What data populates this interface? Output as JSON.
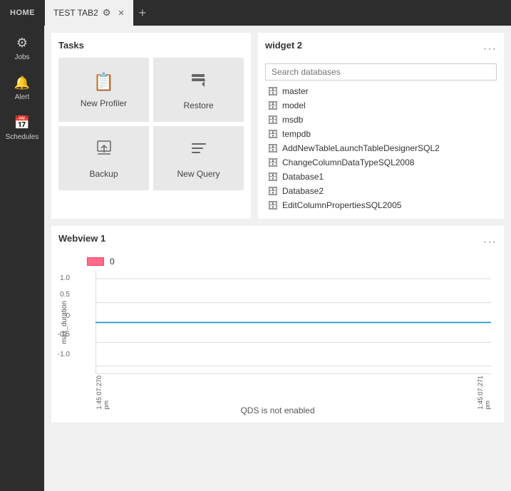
{
  "topbar": {
    "home_label": "HOME",
    "tab_label": "TEST TAB2",
    "tab_add_icon": "+"
  },
  "sidebar": {
    "items": [
      {
        "id": "jobs",
        "icon": "⚙",
        "label": "Jobs"
      },
      {
        "id": "alert",
        "icon": "🔔",
        "label": "Alert"
      },
      {
        "id": "schedules",
        "icon": "📅",
        "label": "Schedules"
      }
    ]
  },
  "tasks_widget": {
    "title": "Tasks",
    "items": [
      {
        "id": "new-profiler",
        "icon": "📋",
        "label": "New Profiler"
      },
      {
        "id": "restore",
        "icon": "🔄",
        "label": "Restore"
      },
      {
        "id": "backup",
        "icon": "📤",
        "label": "Backup"
      },
      {
        "id": "new-query",
        "icon": "≡",
        "label": "New Query"
      }
    ]
  },
  "widget2": {
    "title": "widget 2",
    "menu_icon": "···",
    "search_placeholder": "Search databases",
    "databases": [
      {
        "name": "master"
      },
      {
        "name": "model"
      },
      {
        "name": "msdb"
      },
      {
        "name": "tempdb"
      },
      {
        "name": "AddNewTableLaunchTableDesignerSQL2"
      },
      {
        "name": "ChangeColumnDataTypeSQL2008"
      },
      {
        "name": "Database1"
      },
      {
        "name": "Database2"
      },
      {
        "name": "EditColumnPropertiesSQL2005"
      }
    ]
  },
  "webview_widget": {
    "title": "Webview 1",
    "menu_icon": "···",
    "legend_label": "0",
    "y_axis_label": "max_duration",
    "y_ticks": [
      "1.0",
      "0.5",
      "0",
      "-0.5",
      "-1.0"
    ],
    "x_labels": [
      "1:45:07.270 pm",
      "1:45:07.271 pm"
    ],
    "footer_text": "QDS is not enabled"
  }
}
